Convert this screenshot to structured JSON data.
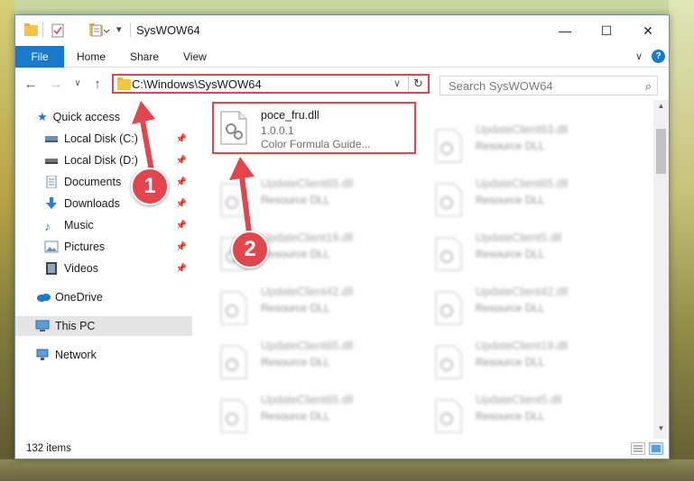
{
  "window": {
    "title": "SysWOW64",
    "minimize_glyph": "—",
    "maximize_glyph": "☐",
    "close_glyph": "✕"
  },
  "ribbon": {
    "file_label": "File",
    "tabs": [
      "Home",
      "Share",
      "View"
    ],
    "expand_glyph": "∨",
    "help_glyph": "?"
  },
  "address": {
    "path": "C:\\Windows\\SysWOW64",
    "search_placeholder": "Search SysWOW64"
  },
  "nav": {
    "quick_access": "Quick access",
    "items": [
      "Local Disk (C:)",
      "Local Disk (D:)",
      "Documents",
      "Downloads",
      "Music",
      "Pictures",
      "Videos"
    ],
    "onedrive": "OneDrive",
    "this_pc": "This PC",
    "network": "Network"
  },
  "files": [
    {
      "name": "poce_fru.dll",
      "line2": "1.0.0.1",
      "line3": "Color Formula Guide..."
    },
    {
      "name": "UpdateClient63.dll",
      "line2": "Resource DLL"
    },
    {
      "name": "UpdateClient65.dll",
      "line2": "Resource DLL"
    },
    {
      "name": "UpdateClient65.dll",
      "line2": "Resource DLL"
    },
    {
      "name": "UpdateClient19.dll",
      "line2": "Resource DLL"
    },
    {
      "name": "UpdateClient5.dll",
      "line2": "Resource DLL"
    },
    {
      "name": "UpdateClient42.dll",
      "line2": "Resource DLL"
    },
    {
      "name": "UpdateClient42.dll",
      "line2": "Resource DLL"
    },
    {
      "name": "UpdateClient65.dll",
      "line2": "Resource DLL"
    },
    {
      "name": "UpdateClient19.dll",
      "line2": "Resource DLL"
    },
    {
      "name": "UpdateClient65.dll",
      "line2": "Resource DLL"
    },
    {
      "name": "UpdateClient5.dll",
      "line2": "Resource DLL"
    }
  ],
  "status": {
    "item_count": "132 items"
  },
  "annotations": {
    "step1": "1",
    "step2": "2",
    "color": "#e2454c"
  },
  "colors": {
    "accent": "#1979ca",
    "highlight": "#e2454c"
  }
}
